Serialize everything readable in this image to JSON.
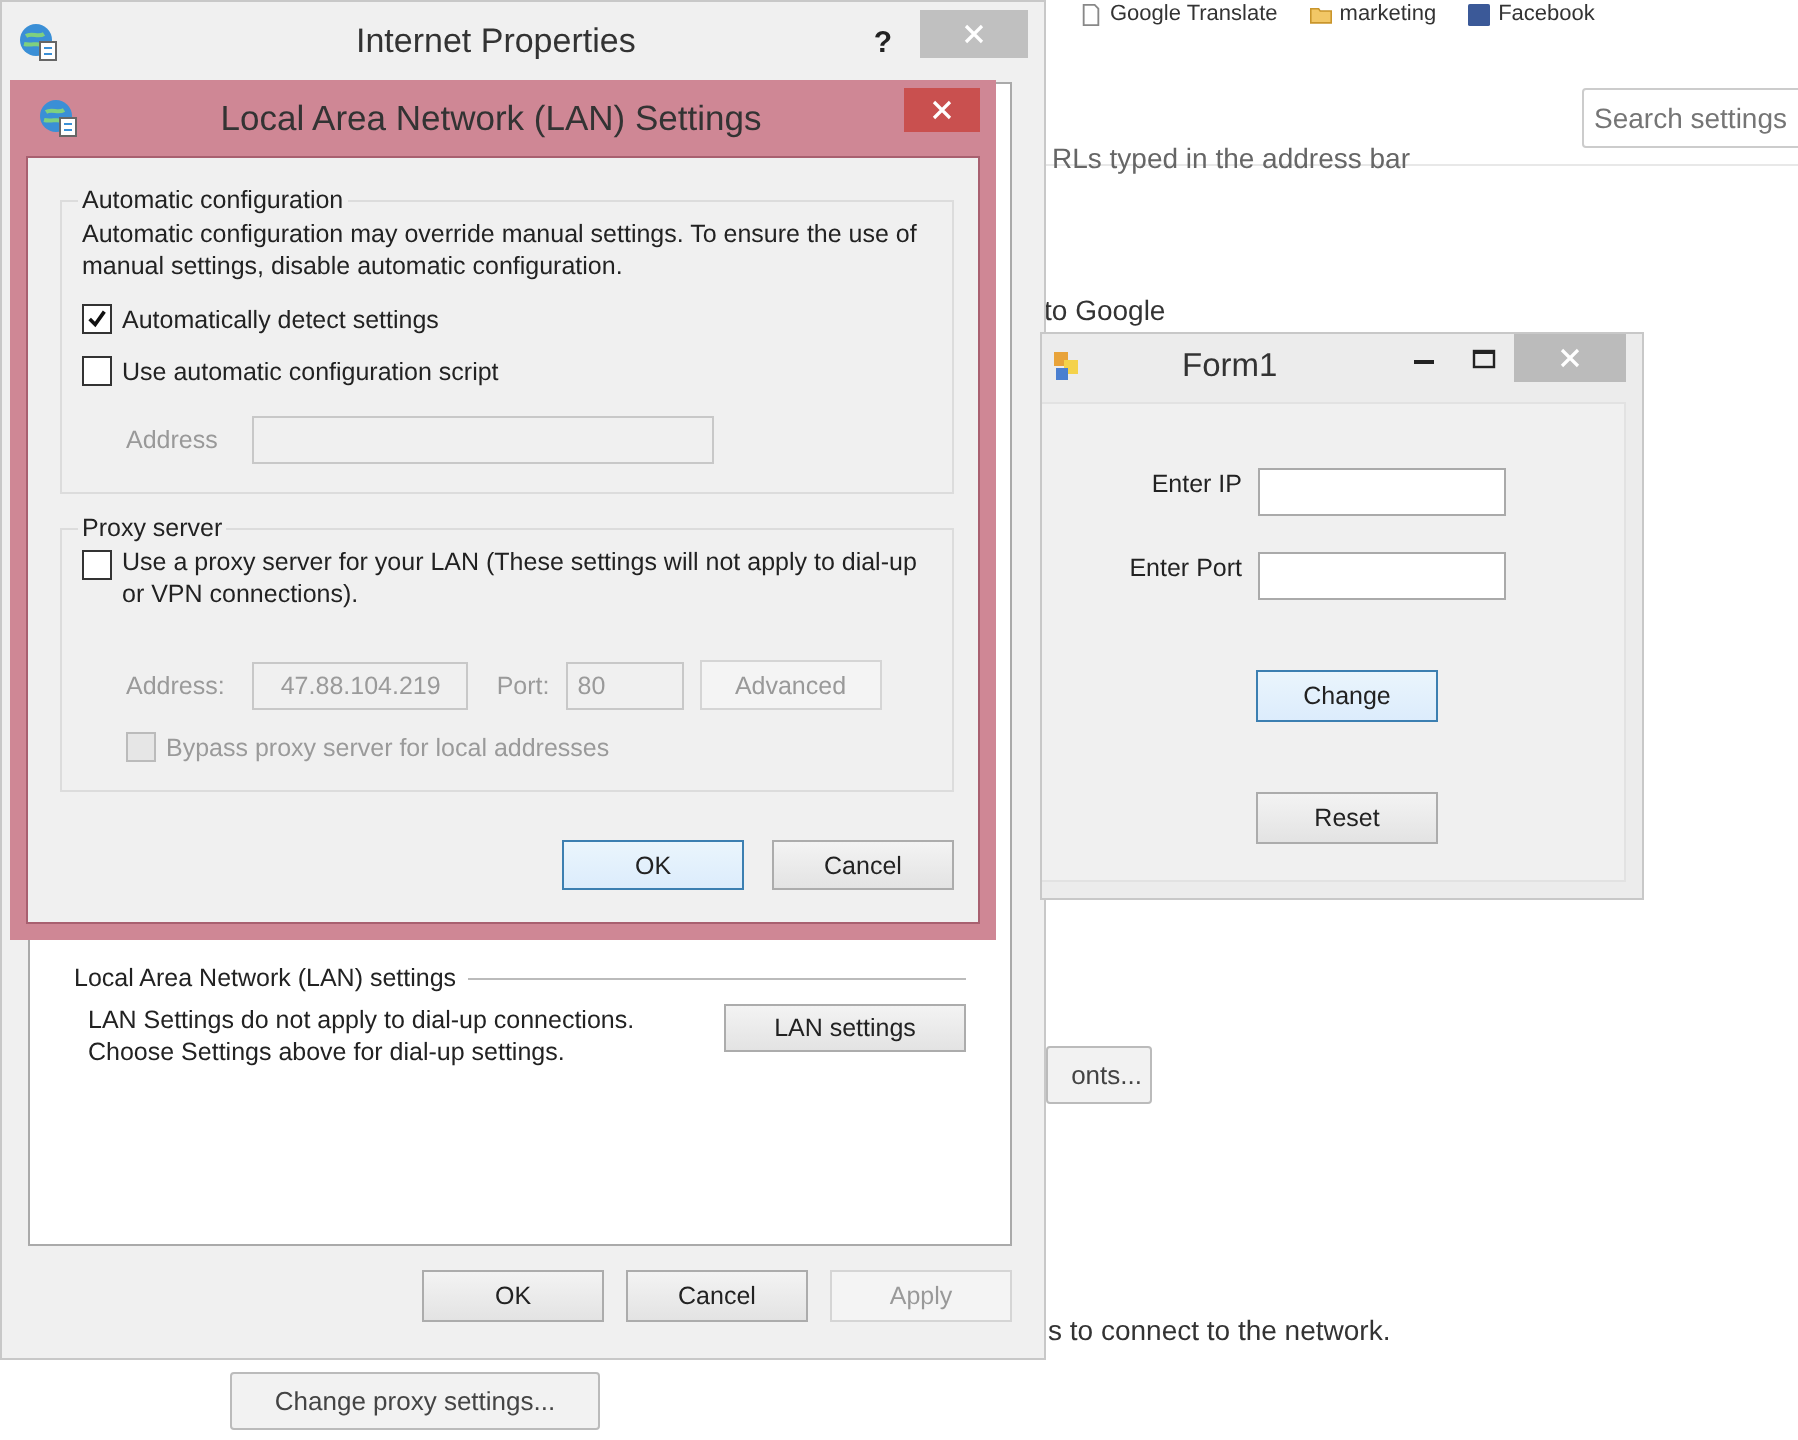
{
  "browser": {
    "bookmarks": [
      {
        "label": "Google Translate",
        "kind": "page"
      },
      {
        "label": "marketing",
        "kind": "folder"
      },
      {
        "label": "Facebook",
        "kind": "social"
      }
    ],
    "search": {
      "placeholder": "Search settings"
    },
    "texts": [
      "RLs typed in the address bar",
      "to Google",
      "s to connect to the network."
    ],
    "buttons": [
      "onts...",
      "Change proxy settings..."
    ]
  },
  "internet_properties": {
    "title": "Internet Properties",
    "help": "?",
    "lan_section": {
      "heading": "Local Area Network (LAN) settings",
      "description": "LAN Settings do not apply to dial-up connections.\nChoose Settings above for dial-up settings.",
      "button": "LAN settings"
    },
    "buttons": [
      {
        "label": "OK",
        "disabled": false
      },
      {
        "label": "Cancel",
        "disabled": false
      },
      {
        "label": "Apply",
        "disabled": true
      }
    ]
  },
  "lan_dialog": {
    "title": "Local Area Network (LAN) Settings",
    "auto_config": {
      "heading": "Automatic configuration",
      "description": "Automatic configuration may override manual settings.  To ensure the use of manual settings, disable automatic configuration.",
      "options": [
        {
          "label": "Automatically detect settings",
          "checked": true
        },
        {
          "label": "Use automatic configuration script",
          "checked": false
        }
      ],
      "address": {
        "label": "Address",
        "disabled": true
      }
    },
    "proxy": {
      "heading": "Proxy server",
      "option": {
        "label": "Use a proxy server for your LAN (These settings will not apply to dial-up or VPN connections).",
        "checked": false
      },
      "disabled": true,
      "address": {
        "label": "Address:",
        "value": "47.88.104.219"
      },
      "port": {
        "label": "Port:",
        "value": "80"
      },
      "advanced": "Advanced",
      "bypass": {
        "label": "Bypass proxy server for local addresses",
        "checked": false
      }
    },
    "buttons": [
      {
        "label": "OK",
        "focused": true
      },
      {
        "label": "Cancel",
        "focused": false
      }
    ]
  },
  "form1": {
    "title": "Form1",
    "fields": [
      {
        "label": "Enter IP"
      },
      {
        "label": "Enter Port"
      }
    ],
    "buttons": [
      {
        "label": "Change",
        "focused": true
      },
      {
        "label": "Reset",
        "focused": false
      }
    ]
  }
}
